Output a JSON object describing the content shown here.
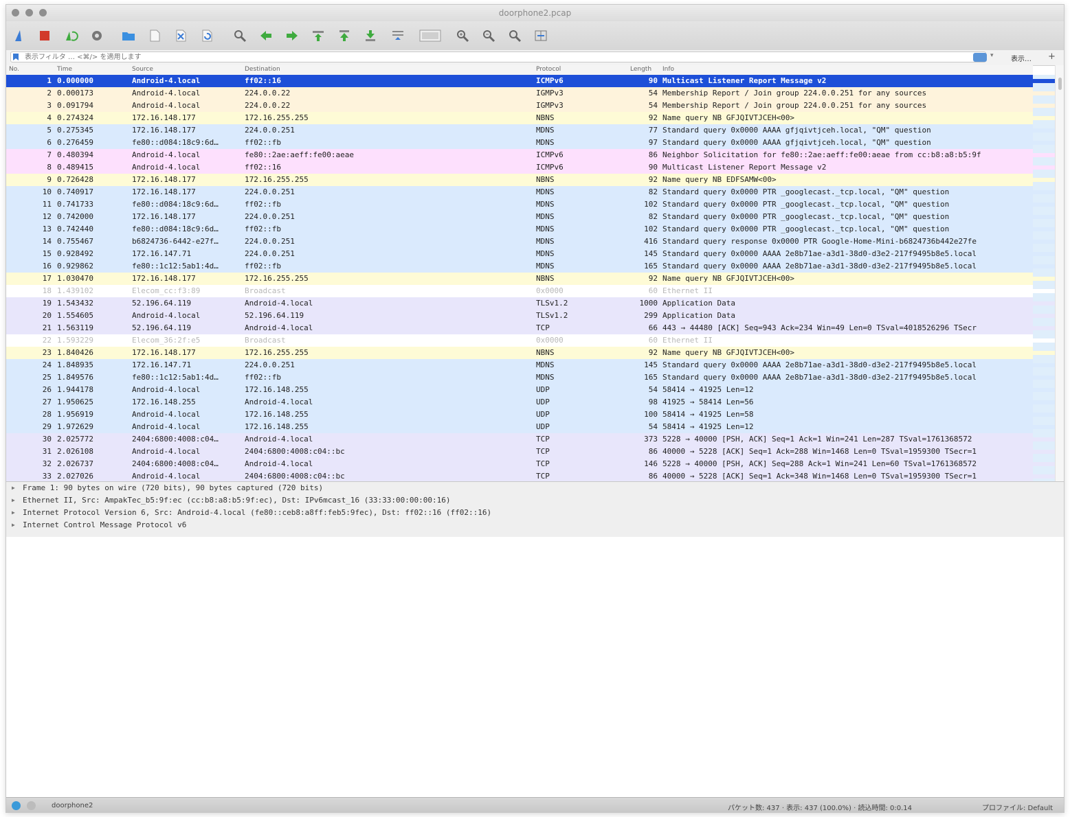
{
  "window": {
    "title": "doorphone2.pcap"
  },
  "filter": {
    "placeholder": "表示フィルタ … <⌘/> を適用します",
    "expression_label": "表示…",
    "add_label": "+"
  },
  "columns": {
    "no": "No.",
    "time": "Time",
    "source": "Source",
    "destination": "Destination",
    "protocol": "Protocol",
    "length": "Length",
    "info": "Info"
  },
  "colors": {
    "selected": "#1d4fd8",
    "icmpv6": "#fde0fd",
    "igmp": "#fef3dc",
    "nbns": "#fefbd6",
    "mdns": "#daeafd",
    "tcp": "#e8e6fb",
    "arp": "#ffffff",
    "toolbar_blue": "#3a7bd5",
    "stop_red": "#d23a2a",
    "go_green": "#3fab3f"
  },
  "toolbar": [
    {
      "name": "start-capture-icon"
    },
    {
      "name": "stop-capture-icon"
    },
    {
      "name": "restart-capture-icon"
    },
    {
      "name": "capture-options-icon"
    },
    {
      "name": "open-file-icon"
    },
    {
      "name": "save-file-icon"
    },
    {
      "name": "close-file-icon"
    },
    {
      "name": "reload-file-icon"
    },
    {
      "name": "find-packet-icon"
    },
    {
      "name": "go-back-icon"
    },
    {
      "name": "go-forward-icon"
    },
    {
      "name": "go-to-packet-icon"
    },
    {
      "name": "go-first-icon"
    },
    {
      "name": "go-last-icon"
    },
    {
      "name": "autoscroll-icon"
    },
    {
      "name": "colorize-icon"
    },
    {
      "name": "zoom-in-icon"
    },
    {
      "name": "zoom-out-icon"
    },
    {
      "name": "zoom-normal-icon"
    },
    {
      "name": "resize-columns-icon"
    }
  ],
  "packets": [
    {
      "no": "1",
      "time": "0.000000",
      "src": "Android-4.local",
      "dst": "ff02::16",
      "proto": "ICMPv6",
      "len": "90",
      "info": "Multicast Listener Report Message v2",
      "kind": "selected"
    },
    {
      "no": "2",
      "time": "0.000173",
      "src": "Android-4.local",
      "dst": "224.0.0.22",
      "proto": "IGMPv3",
      "len": "54",
      "info": "Membership Report / Join group 224.0.0.251 for any sources",
      "kind": "igmp"
    },
    {
      "no": "3",
      "time": "0.091794",
      "src": "Android-4.local",
      "dst": "224.0.0.22",
      "proto": "IGMPv3",
      "len": "54",
      "info": "Membership Report / Join group 224.0.0.251 for any sources",
      "kind": "igmp"
    },
    {
      "no": "4",
      "time": "0.274324",
      "src": "172.16.148.177",
      "dst": "172.16.255.255",
      "proto": "NBNS",
      "len": "92",
      "info": "Name query NB GFJQIVTJCEH<00>",
      "kind": "nbns"
    },
    {
      "no": "5",
      "time": "0.275345",
      "src": "172.16.148.177",
      "dst": "224.0.0.251",
      "proto": "MDNS",
      "len": "77",
      "info": "Standard query 0x0000 AAAA gfjqivtjceh.local, \"QM\" question",
      "kind": "mdns"
    },
    {
      "no": "6",
      "time": "0.276459",
      "src": "fe80::d084:18c9:6d…",
      "dst": "ff02::fb",
      "proto": "MDNS",
      "len": "97",
      "info": "Standard query 0x0000 AAAA gfjqivtjceh.local, \"QM\" question",
      "kind": "mdns"
    },
    {
      "no": "7",
      "time": "0.480394",
      "src": "Android-4.local",
      "dst": "fe80::2ae:aeff:fe00:aeae",
      "proto": "ICMPv6",
      "len": "86",
      "info": "Neighbor Solicitation for fe80::2ae:aeff:fe00:aeae from cc:b8:a8:b5:9f",
      "kind": "icmpv6"
    },
    {
      "no": "8",
      "time": "0.489415",
      "src": "Android-4.local",
      "dst": "ff02::16",
      "proto": "ICMPv6",
      "len": "90",
      "info": "Multicast Listener Report Message v2",
      "kind": "icmpv6"
    },
    {
      "no": "9",
      "time": "0.726428",
      "src": "172.16.148.177",
      "dst": "172.16.255.255",
      "proto": "NBNS",
      "len": "92",
      "info": "Name query NB EDFSAMW<00>",
      "kind": "nbns"
    },
    {
      "no": "10",
      "time": "0.740917",
      "src": "172.16.148.177",
      "dst": "224.0.0.251",
      "proto": "MDNS",
      "len": "82",
      "info": "Standard query 0x0000 PTR _googlecast._tcp.local, \"QM\" question",
      "kind": "mdns"
    },
    {
      "no": "11",
      "time": "0.741733",
      "src": "fe80::d084:18c9:6d…",
      "dst": "ff02::fb",
      "proto": "MDNS",
      "len": "102",
      "info": "Standard query 0x0000 PTR _googlecast._tcp.local, \"QM\" question",
      "kind": "mdns"
    },
    {
      "no": "12",
      "time": "0.742000",
      "src": "172.16.148.177",
      "dst": "224.0.0.251",
      "proto": "MDNS",
      "len": "82",
      "info": "Standard query 0x0000 PTR _googlecast._tcp.local, \"QM\" question",
      "kind": "mdns"
    },
    {
      "no": "13",
      "time": "0.742440",
      "src": "fe80::d084:18c9:6d…",
      "dst": "ff02::fb",
      "proto": "MDNS",
      "len": "102",
      "info": "Standard query 0x0000 PTR _googlecast._tcp.local, \"QM\" question",
      "kind": "mdns"
    },
    {
      "no": "14",
      "time": "0.755467",
      "src": "b6824736-6442-e27f…",
      "dst": "224.0.0.251",
      "proto": "MDNS",
      "len": "416",
      "info": "Standard query response 0x0000 PTR Google-Home-Mini-b6824736b442e27fe",
      "kind": "mdns"
    },
    {
      "no": "15",
      "time": "0.928492",
      "src": "172.16.147.71",
      "dst": "224.0.0.251",
      "proto": "MDNS",
      "len": "145",
      "info": "Standard query 0x0000 AAAA 2e8b71ae-a3d1-38d0-d3e2-217f9495b8e5.local",
      "kind": "mdns"
    },
    {
      "no": "16",
      "time": "0.929862",
      "src": "fe80::1c12:5ab1:4d…",
      "dst": "ff02::fb",
      "proto": "MDNS",
      "len": "165",
      "info": "Standard query 0x0000 AAAA 2e8b71ae-a3d1-38d0-d3e2-217f9495b8e5.local",
      "kind": "mdns"
    },
    {
      "no": "17",
      "time": "1.030470",
      "src": "172.16.148.177",
      "dst": "172.16.255.255",
      "proto": "NBNS",
      "len": "92",
      "info": "Name query NB GFJQIVTJCEH<00>",
      "kind": "nbns"
    },
    {
      "no": "18",
      "time": "1.439102",
      "src": "Elecom_cc:f3:89",
      "dst": "Broadcast",
      "proto": "0x0000",
      "len": "60",
      "info": "Ethernet II",
      "kind": "arp"
    },
    {
      "no": "19",
      "time": "1.543432",
      "src": "52.196.64.119",
      "dst": "Android-4.local",
      "proto": "TLSv1.2",
      "len": "1000",
      "info": "Application Data",
      "kind": "tcp"
    },
    {
      "no": "20",
      "time": "1.554605",
      "src": "Android-4.local",
      "dst": "52.196.64.119",
      "proto": "TLSv1.2",
      "len": "299",
      "info": "Application Data",
      "kind": "tcp"
    },
    {
      "no": "21",
      "time": "1.563119",
      "src": "52.196.64.119",
      "dst": "Android-4.local",
      "proto": "TCP",
      "len": "66",
      "info": "443 → 44480 [ACK] Seq=943 Ack=234 Win=49 Len=0 TSval=4018526296 TSecr",
      "kind": "tcp"
    },
    {
      "no": "22",
      "time": "1.593229",
      "src": "Elecom_36:2f:e5",
      "dst": "Broadcast",
      "proto": "0x0000",
      "len": "60",
      "info": "Ethernet II",
      "kind": "arp"
    },
    {
      "no": "23",
      "time": "1.840426",
      "src": "172.16.148.177",
      "dst": "172.16.255.255",
      "proto": "NBNS",
      "len": "92",
      "info": "Name query NB GFJQIVTJCEH<00>",
      "kind": "nbns"
    },
    {
      "no": "24",
      "time": "1.848935",
      "src": "172.16.147.71",
      "dst": "224.0.0.251",
      "proto": "MDNS",
      "len": "145",
      "info": "Standard query 0x0000 AAAA 2e8b71ae-a3d1-38d0-d3e2-217f9495b8e5.local",
      "kind": "mdns"
    },
    {
      "no": "25",
      "time": "1.849576",
      "src": "fe80::1c12:5ab1:4d…",
      "dst": "ff02::fb",
      "proto": "MDNS",
      "len": "165",
      "info": "Standard query 0x0000 AAAA 2e8b71ae-a3d1-38d0-d3e2-217f9495b8e5.local",
      "kind": "mdns"
    },
    {
      "no": "26",
      "time": "1.944178",
      "src": "Android-4.local",
      "dst": "172.16.148.255",
      "proto": "UDP",
      "len": "54",
      "info": "58414 → 41925 Len=12",
      "kind": "mdns"
    },
    {
      "no": "27",
      "time": "1.950625",
      "src": "172.16.148.255",
      "dst": "Android-4.local",
      "proto": "UDP",
      "len": "98",
      "info": "41925 → 58414 Len=56",
      "kind": "mdns"
    },
    {
      "no": "28",
      "time": "1.956919",
      "src": "Android-4.local",
      "dst": "172.16.148.255",
      "proto": "UDP",
      "len": "100",
      "info": "58414 → 41925 Len=58",
      "kind": "mdns"
    },
    {
      "no": "29",
      "time": "1.972629",
      "src": "Android-4.local",
      "dst": "172.16.148.255",
      "proto": "UDP",
      "len": "54",
      "info": "58414 → 41925 Len=12",
      "kind": "mdns"
    },
    {
      "no": "30",
      "time": "2.025772",
      "src": "2404:6800:4008:c04…",
      "dst": "Android-4.local",
      "proto": "TCP",
      "len": "373",
      "info": "5228 → 40000 [PSH, ACK] Seq=1 Ack=1 Win=241 Len=287 TSval=1761368572",
      "kind": "tcp"
    },
    {
      "no": "31",
      "time": "2.026108",
      "src": "Android-4.local",
      "dst": "2404:6800:4008:c04::bc",
      "proto": "TCP",
      "len": "86",
      "info": "40000 → 5228 [ACK] Seq=1 Ack=288 Win=1468 Len=0 TSval=1959300 TSecr=1",
      "kind": "tcp"
    },
    {
      "no": "32",
      "time": "2.026737",
      "src": "2404:6800:4008:c04…",
      "dst": "Android-4.local",
      "proto": "TCP",
      "len": "146",
      "info": "5228 → 40000 [PSH, ACK] Seq=288 Ack=1 Win=241 Len=60 TSval=1761368572",
      "kind": "tcp"
    },
    {
      "no": "33",
      "time": "2.027026",
      "src": "Android-4.local",
      "dst": "2404:6800:4008:c04::bc",
      "proto": "TCP",
      "len": "86",
      "info": "40000 → 5228 [ACK] Seq=1 Ack=348 Win=1468 Len=0 TSval=1959300 TSecr=1",
      "kind": "tcp"
    }
  ],
  "details": [
    "Frame 1: 90 bytes on wire (720 bits), 90 bytes captured (720 bits)",
    "Ethernet II, Src: AmpakTec_b5:9f:ec (cc:b8:a8:b5:9f:ec), Dst: IPv6mcast_16 (33:33:00:00:00:16)",
    "Internet Protocol Version 6, Src: Android-4.local (fe80::ceb8:a8ff:feb5:9fec), Dst: ff02::16 (ff02::16)",
    "Internet Control Message Protocol v6"
  ],
  "status": {
    "file": "doorphone2",
    "packets": "パケット数: 437 · 表示: 437 (100.0%) · 読込時間: 0:0.14",
    "profile": "プロファイル: Default"
  }
}
